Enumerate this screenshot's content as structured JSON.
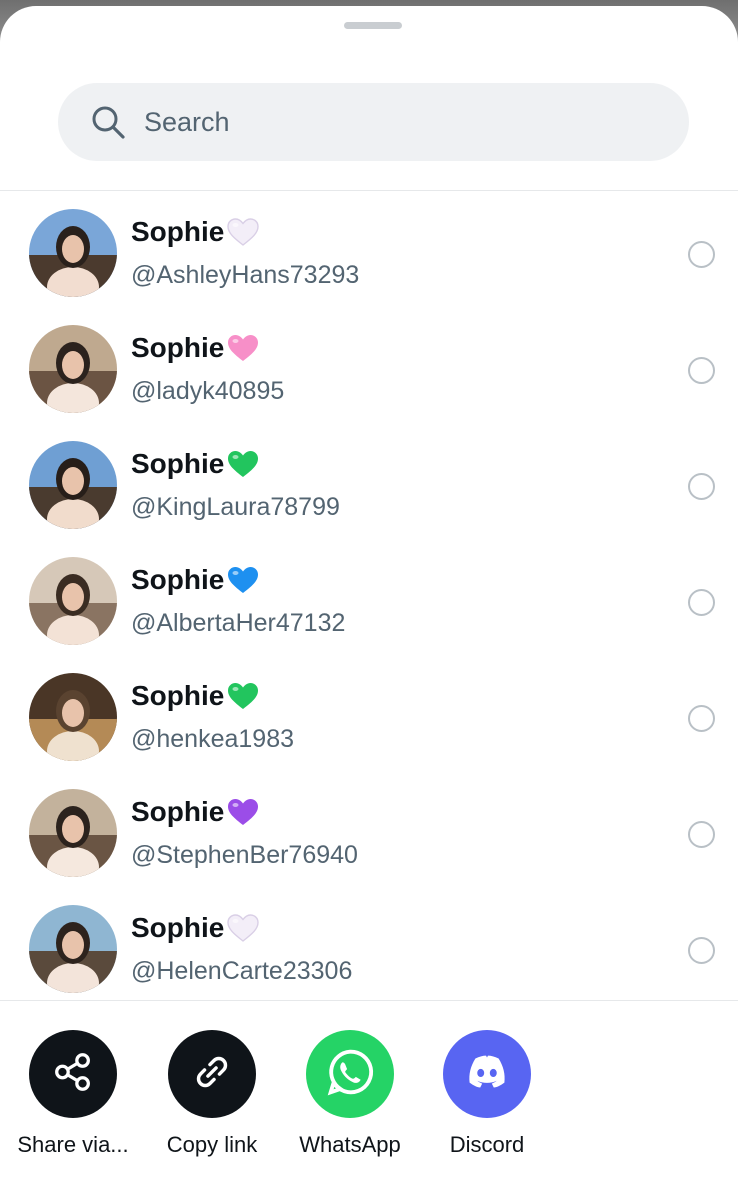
{
  "search": {
    "placeholder": "Search",
    "icon": "search-icon"
  },
  "contacts": [
    {
      "name": "Sophie",
      "handle": "@AshleyHans73293",
      "heart": "white",
      "heart_color": "#f3eef8"
    },
    {
      "name": "Sophie",
      "handle": "@ladyk40895",
      "heart": "pink",
      "heart_color": "#f78fc8"
    },
    {
      "name": "Sophie",
      "handle": "@KingLaura78799",
      "heart": "green",
      "heart_color": "#22c55e"
    },
    {
      "name": "Sophie",
      "handle": "@AlbertaHer47132",
      "heart": "blue",
      "heart_color": "#1e90f0"
    },
    {
      "name": "Sophie",
      "handle": "@henkea1983",
      "heart": "green",
      "heart_color": "#22c55e"
    },
    {
      "name": "Sophie",
      "handle": "@StephenBer76940",
      "heart": "purple",
      "heart_color": "#9b4de8"
    },
    {
      "name": "Sophie",
      "handle": "@HelenCarte23306",
      "heart": "white",
      "heart_color": "#f3eef8"
    }
  ],
  "share": [
    {
      "label": "Share via...",
      "icon": "share-icon",
      "color": "#0f1419"
    },
    {
      "label": "Copy link",
      "icon": "link-icon",
      "color": "#0f1419"
    },
    {
      "label": "WhatsApp",
      "icon": "whatsapp-icon",
      "color": "#25d366"
    },
    {
      "label": "Discord",
      "icon": "discord-icon",
      "color": "#5865f2"
    }
  ]
}
